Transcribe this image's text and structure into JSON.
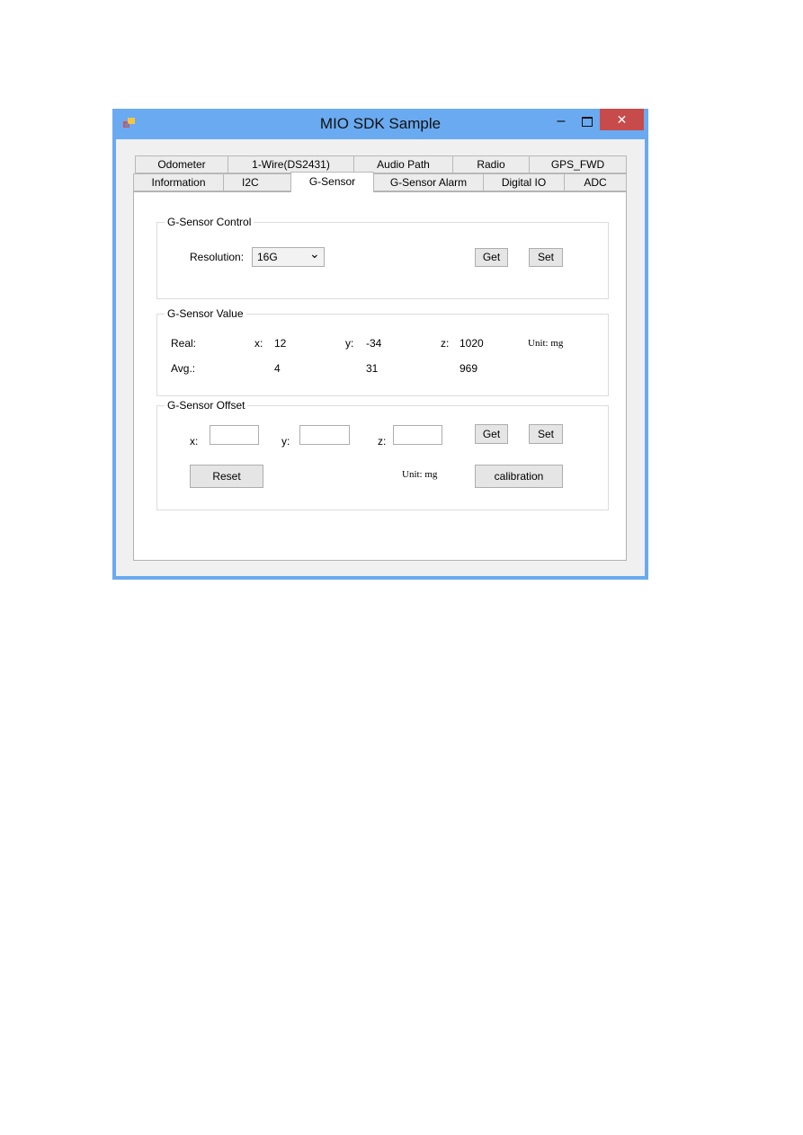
{
  "window": {
    "title": "MIO SDK Sample",
    "minimize": "–",
    "close": "✕",
    "title_color": "#6aaaf0",
    "close_color": "#c74b4b"
  },
  "tabs": {
    "row1": [
      "Odometer",
      "1-Wire(DS2431)",
      "Audio Path",
      "Radio",
      "GPS_FWD"
    ],
    "row2": [
      "Information",
      "I2C",
      "G-Sensor",
      "G-Sensor Alarm",
      "Digital IO",
      "ADC"
    ],
    "selected": "G-Sensor"
  },
  "control": {
    "legend": "G-Sensor Control",
    "resolution_label": "Resolution:",
    "resolution_value": "16G",
    "chevron": "⌄",
    "get": "Get",
    "set": "Set"
  },
  "value": {
    "legend": "G-Sensor Value",
    "real_label": "Real:",
    "avg_label": "Avg.:",
    "x_label": "x:",
    "y_label": "y:",
    "z_label": "z:",
    "real": {
      "x": "12",
      "y": "-34",
      "z": "1020"
    },
    "avg": {
      "x": "4",
      "y": "31",
      "z": "969"
    },
    "unit": "Unit: mg"
  },
  "offset": {
    "legend": "G-Sensor Offset",
    "x_label": "x:",
    "y_label": "y:",
    "z_label": "z:",
    "x_value": "",
    "y_value": "",
    "z_value": "",
    "get": "Get",
    "set": "Set",
    "reset": "Reset",
    "unit": "Unit: mg",
    "calibration": "calibration"
  }
}
